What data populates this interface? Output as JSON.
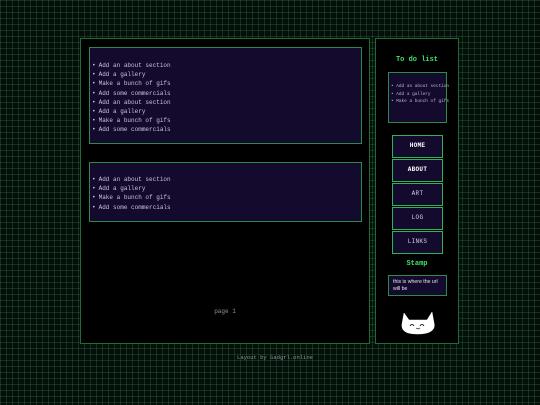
{
  "main": {
    "list1": [
      "Add an about section",
      "Add a gallery",
      "Make a bunch of gifs",
      "Add some commercials",
      "Add an about section",
      "Add a gallery",
      "Make a bunch of gifs",
      "Add some commercials"
    ],
    "list2": [
      "Add an about section",
      "Add a gallery",
      "Make a bunch of gifs",
      "Add some commercials"
    ],
    "page_label": "page 1"
  },
  "sidebar": {
    "todo_title": "To do list",
    "todo_items": [
      "Add an about section",
      "Add a gallery",
      "Make a bunch of gifs"
    ],
    "nav": [
      "HOME",
      "ABOUT",
      "ART",
      "LOG",
      "LINKS"
    ],
    "stamp_title": "Stamp",
    "stamp_text": "this is where the url will be"
  },
  "footer": "Layout by Sadgrl.online",
  "colors": {
    "accent": "#3fe06a",
    "panel": "#140a2e",
    "border": "#2c8a4a",
    "background": "#000000"
  },
  "icons": {
    "cat": "cat-illustration"
  }
}
